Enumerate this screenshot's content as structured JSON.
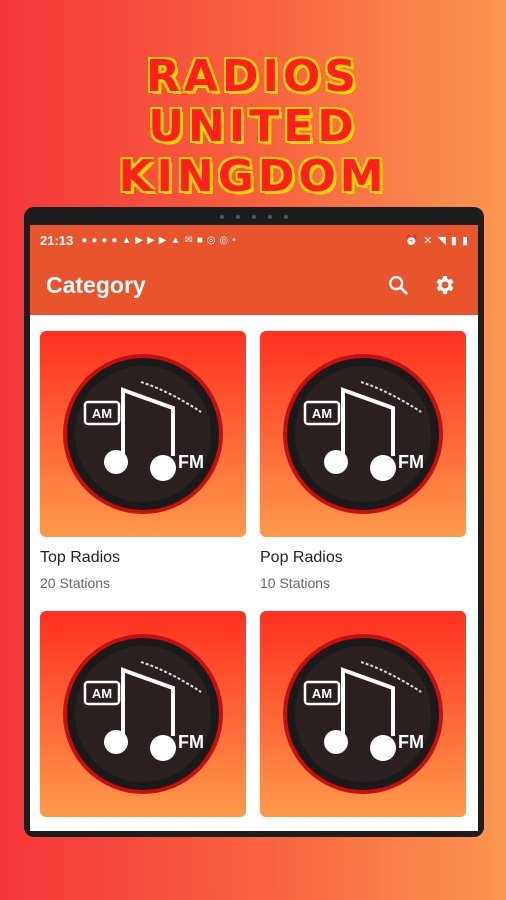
{
  "promo": {
    "line1": "RADIOS",
    "line2": "UNITED",
    "line3": "KINGDOM"
  },
  "status_bar": {
    "time": "21:13",
    "app_icons": [
      "messenger-icon",
      "facebook-icon",
      "facebook-icon",
      "facebook-icon",
      "twitter-icon",
      "youtube-icon",
      "youtube-icon",
      "youtube-icon",
      "twitter-icon",
      "gmail-icon",
      "outlook-icon",
      "instagram-icon",
      "instagram-icon"
    ],
    "system_icons": [
      "alarm-icon",
      "mute-icon",
      "wifi-icon",
      "signal-icon",
      "battery-icon"
    ]
  },
  "app_bar": {
    "title": "Category",
    "search_icon": "search-icon",
    "settings_icon": "gear-icon"
  },
  "categories": [
    {
      "name": "Top Radios",
      "count": "20 Stations"
    },
    {
      "name": "Pop Radios",
      "count": "10 Stations"
    },
    {
      "name": "",
      "count": ""
    },
    {
      "name": "",
      "count": ""
    }
  ],
  "thumbnail": {
    "am_label": "AM",
    "fm_label": "FM"
  },
  "colors": {
    "app_bar": "#e8552c",
    "promo_text": "#ff1f1f",
    "promo_outline": "#ffd400"
  }
}
